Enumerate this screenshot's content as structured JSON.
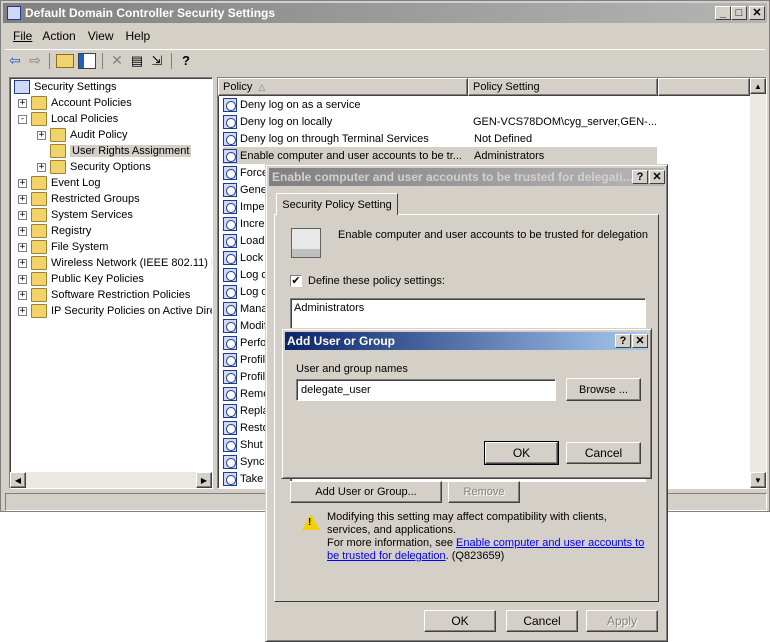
{
  "window": {
    "title": "Default Domain Controller Security Settings"
  },
  "menu": [
    "File",
    "Action",
    "View",
    "Help"
  ],
  "tree": {
    "root": "Security Settings",
    "items": [
      {
        "label": "Account Policies",
        "indent": 1,
        "exp": "+"
      },
      {
        "label": "Local Policies",
        "indent": 1,
        "exp": "-"
      },
      {
        "label": "Audit Policy",
        "indent": 2,
        "exp": "+"
      },
      {
        "label": "User Rights Assignment",
        "indent": 2,
        "exp": "",
        "selected": true
      },
      {
        "label": "Security Options",
        "indent": 2,
        "exp": "+"
      },
      {
        "label": "Event Log",
        "indent": 1,
        "exp": "+"
      },
      {
        "label": "Restricted Groups",
        "indent": 1,
        "exp": "+"
      },
      {
        "label": "System Services",
        "indent": 1,
        "exp": "+"
      },
      {
        "label": "Registry",
        "indent": 1,
        "exp": "+"
      },
      {
        "label": "File System",
        "indent": 1,
        "exp": "+"
      },
      {
        "label": "Wireless Network (IEEE 802.11) P",
        "indent": 1,
        "exp": "+"
      },
      {
        "label": "Public Key Policies",
        "indent": 1,
        "exp": "+"
      },
      {
        "label": "Software Restriction Policies",
        "indent": 1,
        "exp": "+"
      },
      {
        "label": "IP Security Policies on Active Dire",
        "indent": 1,
        "exp": "+"
      }
    ]
  },
  "list": {
    "col_policy": "Policy",
    "col_setting": "Policy Setting",
    "rows": [
      {
        "policy": "Deny log on as a service",
        "setting": ""
      },
      {
        "policy": "Deny log on locally",
        "setting": "GEN-VCS78DOM\\cyg_server,GEN-..."
      },
      {
        "policy": "Deny log on through Terminal Services",
        "setting": "Not Defined"
      },
      {
        "policy": "Enable computer and user accounts to be tr...",
        "setting": "Administrators",
        "highlight": true
      },
      {
        "policy": "Force",
        "setting": ""
      },
      {
        "policy": "Gener",
        "setting": ""
      },
      {
        "policy": "Imper",
        "setting": ""
      },
      {
        "policy": "Increa",
        "setting": ""
      },
      {
        "policy": "Load",
        "setting": ""
      },
      {
        "policy": "Lock p",
        "setting": ""
      },
      {
        "policy": "Log o",
        "setting": ""
      },
      {
        "policy": "Log o",
        "setting": ""
      },
      {
        "policy": "Mana",
        "setting": ""
      },
      {
        "policy": "Modif",
        "setting": ""
      },
      {
        "policy": "Perfo",
        "setting": ""
      },
      {
        "policy": "Profile",
        "setting": ""
      },
      {
        "policy": "Profile",
        "setting": ""
      },
      {
        "policy": "Remo",
        "setting": ""
      },
      {
        "policy": "Repla",
        "setting": ""
      },
      {
        "policy": "Resto",
        "setting": ""
      },
      {
        "policy": "Shut",
        "setting": ""
      },
      {
        "policy": "Synch",
        "setting": ""
      },
      {
        "policy": "Take",
        "setting": ""
      }
    ]
  },
  "policy_dialog": {
    "title": "Enable computer and user accounts to be trusted for delegati...",
    "tab": "Security Policy Setting",
    "heading": "Enable computer and user accounts to be trusted for delegation",
    "define_label": "Define these policy settings:",
    "define_checked": true,
    "entries": [
      "Administrators"
    ],
    "add_label": "Add User or Group...",
    "remove_label": "Remove",
    "warning_text": "Modifying this setting may affect compatibility with clients, services, and applications.",
    "info_prefix": "For more information, see ",
    "info_link": "Enable computer and user accounts to be trusted for delegation",
    "info_suffix": ". (Q823659)",
    "ok": "OK",
    "cancel": "Cancel",
    "apply": "Apply"
  },
  "add_dialog": {
    "title": "Add User or Group",
    "names_label": "User and group names",
    "names_value": "delegate_user",
    "browse": "Browse ...",
    "ok": "OK",
    "cancel": "Cancel"
  },
  "colors": {
    "titlebar_active": "#0a246a",
    "titlebar_inactive": "#808080",
    "face": "#d4d0c8",
    "selection": "#d4d0c8",
    "link": "#0000ff"
  }
}
